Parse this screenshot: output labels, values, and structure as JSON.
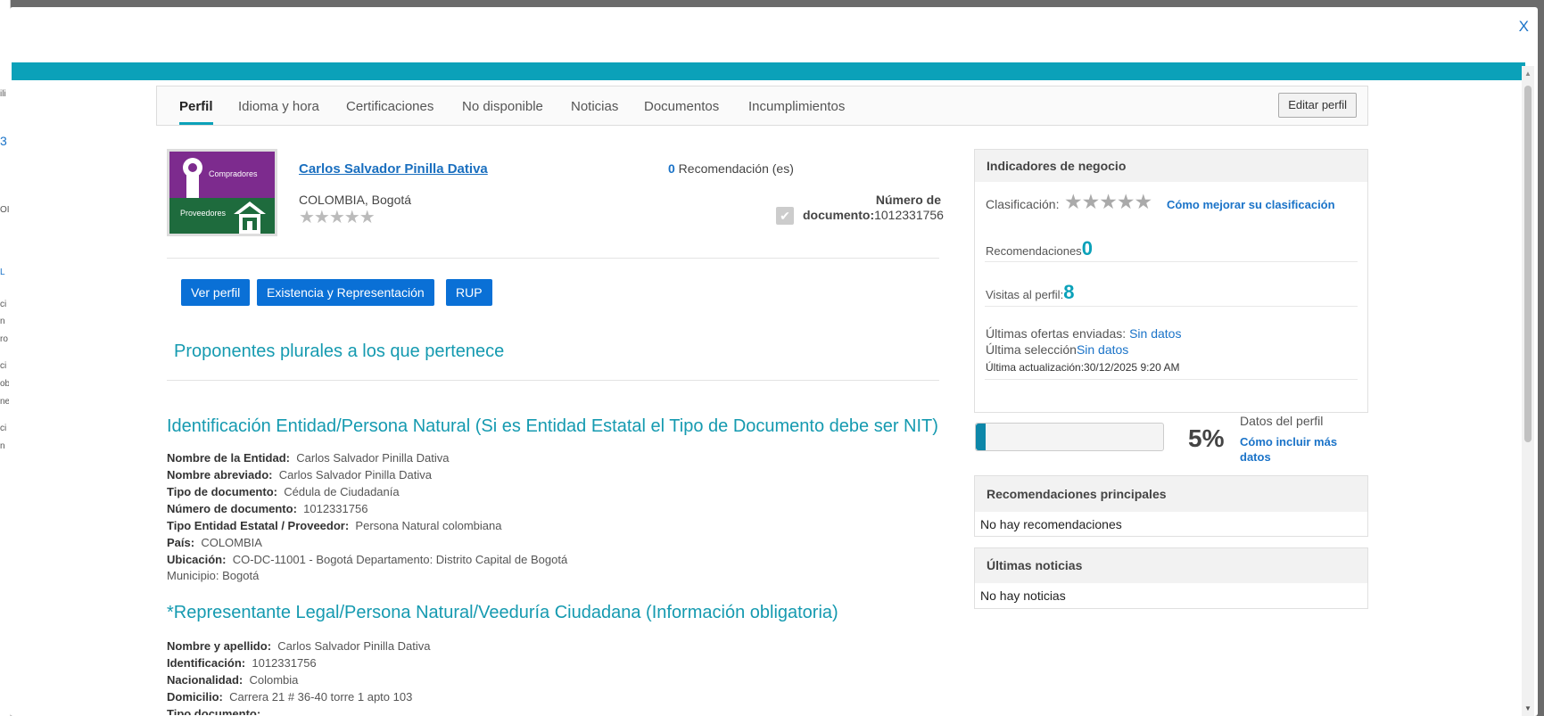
{
  "background": {
    "side_chars": [
      "ili",
      "3",
      "OI",
      "L",
      "ci",
      "n",
      "ro",
      "ci",
      "ob",
      "ne",
      "ci",
      "n"
    ]
  },
  "modal": {
    "close_label": "X"
  },
  "tabs": {
    "items": [
      "Perfil",
      "Idioma y hora",
      "Certificaciones",
      "No disponible",
      "Noticias",
      "Documentos",
      "Incumplimientos"
    ],
    "edit_label": "Editar perfil"
  },
  "profile": {
    "logo_top": "Compradores",
    "logo_bottom": "Proveedores",
    "name": "Carlos Salvador Pinilla Dativa",
    "location": "COLOMBIA, Bogotá",
    "stars": "★★★★★",
    "recom_count": "0",
    "recom_label": " Recomendación (es)",
    "doc_label_bold": "Número de documento:",
    "doc_number": "1012331756"
  },
  "buttons": {
    "ver_perfil": "Ver perfil",
    "existencia": "Existencia y Representación",
    "rup": "RUP"
  },
  "sections": {
    "plural": "Proponentes plurales a los que pertenece",
    "identificacion": "Identificación Entidad/Persona Natural (Si es Entidad Estatal el Tipo de Documento debe ser NIT)",
    "representante": "*Representante Legal/Persona Natural/Veeduría Ciudadana (Información obligatoria)"
  },
  "entidad": {
    "nombre_label": "Nombre de la Entidad:",
    "nombre": "Carlos Salvador Pinilla Dativa",
    "abreviado_label": "Nombre abreviado:",
    "abreviado": "Carlos Salvador Pinilla Dativa",
    "tipo_doc_label": "Tipo de documento:",
    "tipo_doc": "Cédula de Ciudadanía",
    "num_doc_label": "Número de documento:",
    "num_doc": "1012331756",
    "tipo_entidad_label": "Tipo Entidad Estatal / Proveedor:",
    "tipo_entidad": "Persona Natural colombiana",
    "pais_label": "País:",
    "pais": "COLOMBIA",
    "ubicacion_label": "Ubicación:",
    "ubicacion": "CO-DC-11001 - Bogotá Departamento: Distrito Capital de Bogotá",
    "municipio": "Municipio: Bogotá"
  },
  "representante": {
    "nombre_label": "Nombre y apellido:",
    "nombre": "Carlos Salvador Pinilla Dativa",
    "ident_label": "Identificación:",
    "ident": "1012331756",
    "nac_label": "Nacionalidad:",
    "nac": "Colombia",
    "dom_label": "Domicilio:",
    "dom": "Carrera 21 # 36-40 torre 1 apto 103",
    "tipo_label": "Tipo documento:"
  },
  "indicadores": {
    "title": "Indicadores de negocio",
    "clasificacion_label": "Clasificación:",
    "stars": "★★★★★",
    "mejorar_link": "Cómo mejorar su clasificación",
    "recom_label": "Recomendaciones",
    "recom_value": "0",
    "visitas_label": "Visitas al perfil:",
    "visitas_value": "8",
    "ofertas_label": "Últimas ofertas enviadas: ",
    "ofertas_value": "Sin datos",
    "seleccion_label": "Última selección",
    "seleccion_value": "Sin datos",
    "actualizacion": "Última actualización:30/12/2025 9:20 AM"
  },
  "perfil_datos": {
    "percent": "5%",
    "fraction": 0.05,
    "label": "Datos del perfil",
    "link": "Cómo incluir más datos"
  },
  "recomendaciones": {
    "title": "Recomendaciones principales",
    "empty": "No hay recomendaciones"
  },
  "noticias": {
    "title": "Últimas noticias",
    "empty": "No hay noticias"
  }
}
